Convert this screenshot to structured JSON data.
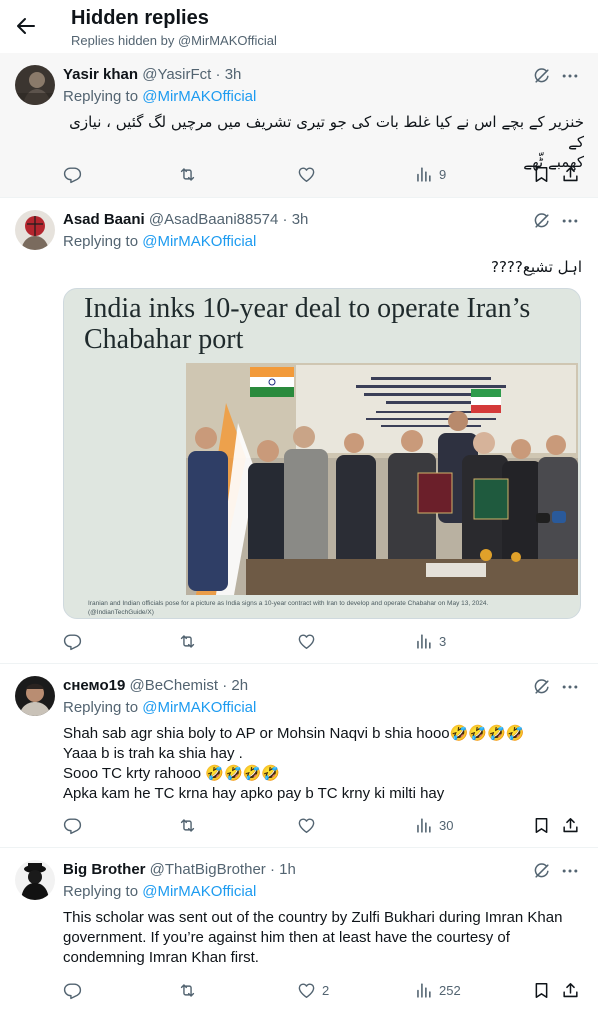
{
  "header": {
    "title": "Hidden replies",
    "subtitle": "Replies hidden by @MirMAKOfficial"
  },
  "reply_prefix": "Replying to ",
  "posts": [
    {
      "name": "Yasir khan",
      "handle": "@YasirFct",
      "time": "3h",
      "mention": "@MirMAKOfficial",
      "lines": [
        "خنزیر کے بچے اس نے کیا غلط بات کی جو تیری تشریف میں مرچیں لگ گئیں ، نیازی کے",
        "کھمبے ٹّھے"
      ],
      "stats": {
        "replies": "",
        "reposts": "",
        "likes": "",
        "views": "9"
      }
    },
    {
      "name": "Asad Baani",
      "handle": "@AsadBaani88574",
      "time": "3h",
      "mention": "@MirMAKOfficial",
      "lines": [
        "اہل تشیع????"
      ],
      "media": {
        "headline": "India inks 10-year deal to operate Iran’s Chabahar port",
        "caption_line1": "Iranian and Indian officials pose for a picture as India signs a 10-year contract with Iran to develop and operate Chabahar on May 13, 2024.",
        "caption_line2": "(@IndianTechGuide/X)"
      },
      "stats": {
        "replies": "",
        "reposts": "",
        "likes": "",
        "views": "3"
      }
    },
    {
      "name": "снемо19",
      "handle": "@BeChemist",
      "time": "2h",
      "mention": "@MirMAKOfficial",
      "lines": [
        "Shah sab agr shia boly to AP or Mohsin Naqvi b shia hooo🤣🤣🤣🤣",
        "Yaaa b is trah ka shia hay .",
        "Sooo TC krty rahooo 🤣🤣🤣🤣",
        "Apka kam he TC krna hay apko pay b TC krny ki milti hay"
      ],
      "stats": {
        "replies": "",
        "reposts": "",
        "likes": "",
        "views": "30"
      }
    },
    {
      "name": "Big Brother",
      "handle": "@ThatBigBrother",
      "time": "1h",
      "mention": "@MirMAKOfficial",
      "lines": [
        "This scholar was sent out of the country by Zulfi Bukhari during Imran Khan",
        "government. If you’re against him then at least have the courtesy of",
        "condemning Imran Khan first."
      ],
      "stats": {
        "replies": "",
        "reposts": "",
        "likes": "2",
        "views": "252"
      }
    }
  ],
  "icons": {
    "back": "arrow-left-icon",
    "grok": "grok-icon",
    "more": "more-dots-icon",
    "reply": "reply-bubble-icon",
    "repost": "repost-arrows-icon",
    "like": "heart-icon",
    "views": "views-bars-icon",
    "bookmark": "bookmark-icon",
    "share": "share-icon"
  },
  "colors": {
    "text": "#0f1419",
    "muted": "#536471",
    "link": "#1d9bf0",
    "hidden_post_bg": "#f7f7f7",
    "divider": "#eff3f4"
  }
}
